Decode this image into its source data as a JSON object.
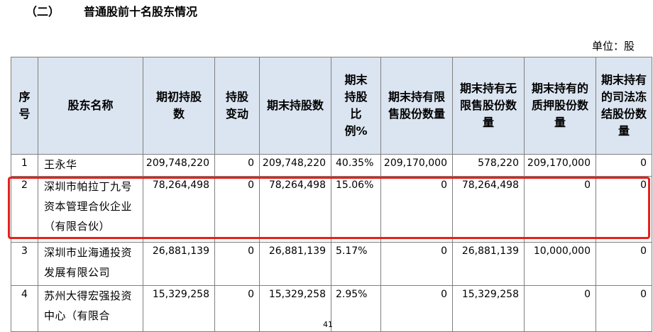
{
  "section": {
    "number": "（二）",
    "title": "普通股前十名股东情况"
  },
  "unit_label": "单位：股",
  "table": {
    "headers": [
      "序号",
      "股东名称",
      "期初持股数",
      "持股变动",
      "期末持股数",
      "期末持股比例%",
      "期末持有限售股份数量",
      "期末持有无限售股份数量",
      "期末持有的质押股份数量",
      "期末持有的司法冻结股份数量"
    ],
    "rows": [
      {
        "idx": "1",
        "name": "王永华",
        "begin": "209,748,220",
        "change": "0",
        "end": "209,748,220",
        "ratio": "40.35%",
        "restricted": "209,170,000",
        "unrestricted": "578,220",
        "pledged": "209,170,000",
        "frozen": "0"
      },
      {
        "idx": "2",
        "name": "深圳市帕拉丁九号资本管理合伙企业（有限合伙）",
        "begin": "78,264,498",
        "change": "0",
        "end": "78,264,498",
        "ratio": "15.06%",
        "restricted": "0",
        "unrestricted": "78,264,498",
        "pledged": "0",
        "frozen": "0"
      },
      {
        "idx": "3",
        "name": "深圳市业海通投资发展有限公司",
        "begin": "26,881,139",
        "change": "0",
        "end": "26,881,139",
        "ratio": "5.17%",
        "restricted": "0",
        "unrestricted": "26,881,139",
        "pledged": "10,000,000",
        "frozen": "0"
      },
      {
        "idx": "4",
        "name": "苏州大得宏强投资中心（有限合",
        "begin": "15,329,258",
        "change": "0",
        "end": "15,329,258",
        "ratio": "2.95%",
        "restricted": "0",
        "unrestricted": "15,329,258",
        "pledged": "0",
        "frozen": "0"
      }
    ]
  },
  "highlight_color": "#e5211b",
  "page_number": "41"
}
